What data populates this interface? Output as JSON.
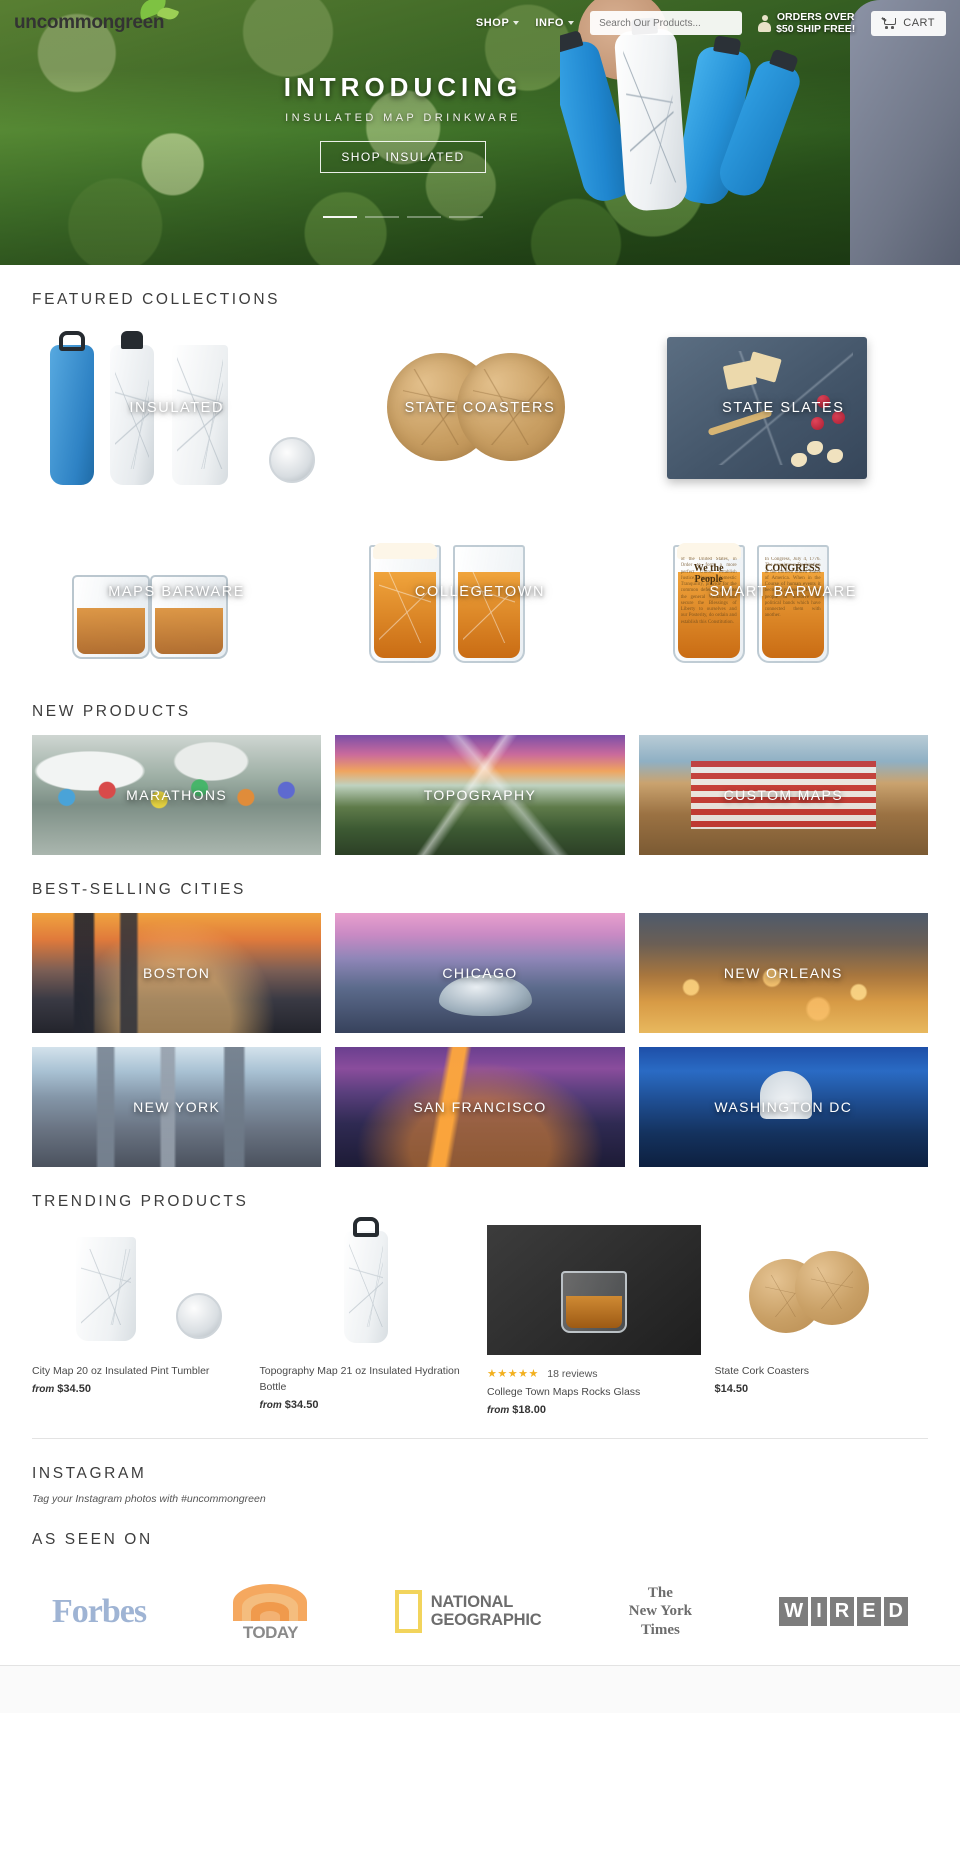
{
  "header": {
    "logo_text_1": "uncommon",
    "logo_text_2": "green",
    "nav": [
      {
        "label": "SHOP",
        "icon": "chevron-down-icon"
      },
      {
        "label": "INFO",
        "icon": "chevron-down-icon"
      }
    ],
    "search_placeholder": "Search Our Products...",
    "search_value": "",
    "promo_line_1": "ORDERS OVER",
    "promo_line_2": "$50 SHIP FREE!",
    "cart_label": "CART"
  },
  "hero": {
    "title": "INTRODUCING",
    "subtitle": "INSULATED MAP DRINKWARE",
    "button": "SHOP INSULATED",
    "slides": 4,
    "active_slide": 1
  },
  "featured": {
    "heading": "FEATURED COLLECTIONS",
    "tiles": [
      {
        "label": "INSULATED",
        "art": "insulated"
      },
      {
        "label": "STATE COASTERS",
        "art": "coasters"
      },
      {
        "label": "STATE SLATES",
        "art": "slates"
      },
      {
        "label": "MAPS BARWARE",
        "art": "rocks"
      },
      {
        "label": "COLLEGETOWN",
        "art": "pints"
      },
      {
        "label": "SMART BARWARE",
        "art": "smart"
      }
    ]
  },
  "new_products": {
    "heading": "NEW PRODUCTS",
    "tiles": [
      {
        "label": "MARATHONS",
        "bg": "marathon"
      },
      {
        "label": "TOPOGRAPHY",
        "bg": "topo"
      },
      {
        "label": "CUSTOM MAPS",
        "bg": "custom"
      }
    ]
  },
  "cities": {
    "heading": "BEST-SELLING CITIES",
    "tiles": [
      {
        "label": "BOSTON",
        "bg": "boston"
      },
      {
        "label": "CHICAGO",
        "bg": "chicago"
      },
      {
        "label": "NEW ORLEANS",
        "bg": "neworleans"
      },
      {
        "label": "NEW YORK",
        "bg": "newyork"
      },
      {
        "label": "SAN FRANCISCO",
        "bg": "sanfrancisco"
      },
      {
        "label": "WASHINGTON DC",
        "bg": "washingtondc"
      }
    ]
  },
  "trending": {
    "heading": "TRENDING PRODUCTS",
    "products": [
      {
        "name": "City Map 20 oz Insulated Pint Tumbler",
        "price_prefix": "from",
        "price": "$34.50",
        "rating": null,
        "reviews": null
      },
      {
        "name": "Topography Map 21 oz Insulated Hydration Bottle",
        "price_prefix": "from",
        "price": "$34.50",
        "rating": null,
        "reviews": null
      },
      {
        "name": "College Town Maps Rocks Glass",
        "price_prefix": "from",
        "price": "$18.00",
        "rating": "★★★★★",
        "reviews": "18 reviews"
      },
      {
        "name": "State Cork Coasters",
        "price_prefix": "",
        "price": "$14.50",
        "rating": null,
        "reviews": null
      }
    ]
  },
  "instagram": {
    "heading": "INSTAGRAM",
    "note": "Tag your Instagram photos with #uncommongreen"
  },
  "as_seen_on": {
    "heading": "AS SEEN ON",
    "logos": [
      {
        "name": "forbes",
        "text": "Forbes"
      },
      {
        "name": "today",
        "text": "TODAY"
      },
      {
        "name": "national-geographic",
        "line1": "NATIONAL",
        "line2": "GEOGRAPHIC"
      },
      {
        "name": "new-york-times",
        "line1": "The",
        "line2": "New York",
        "line3": "Times"
      },
      {
        "name": "wired",
        "letters": [
          "W",
          "I",
          "R",
          "E",
          "D"
        ]
      }
    ]
  },
  "colors": {
    "accent_green": "#a9d44a",
    "star_gold": "#f2b01e",
    "text_dark": "#3d3d3d"
  }
}
